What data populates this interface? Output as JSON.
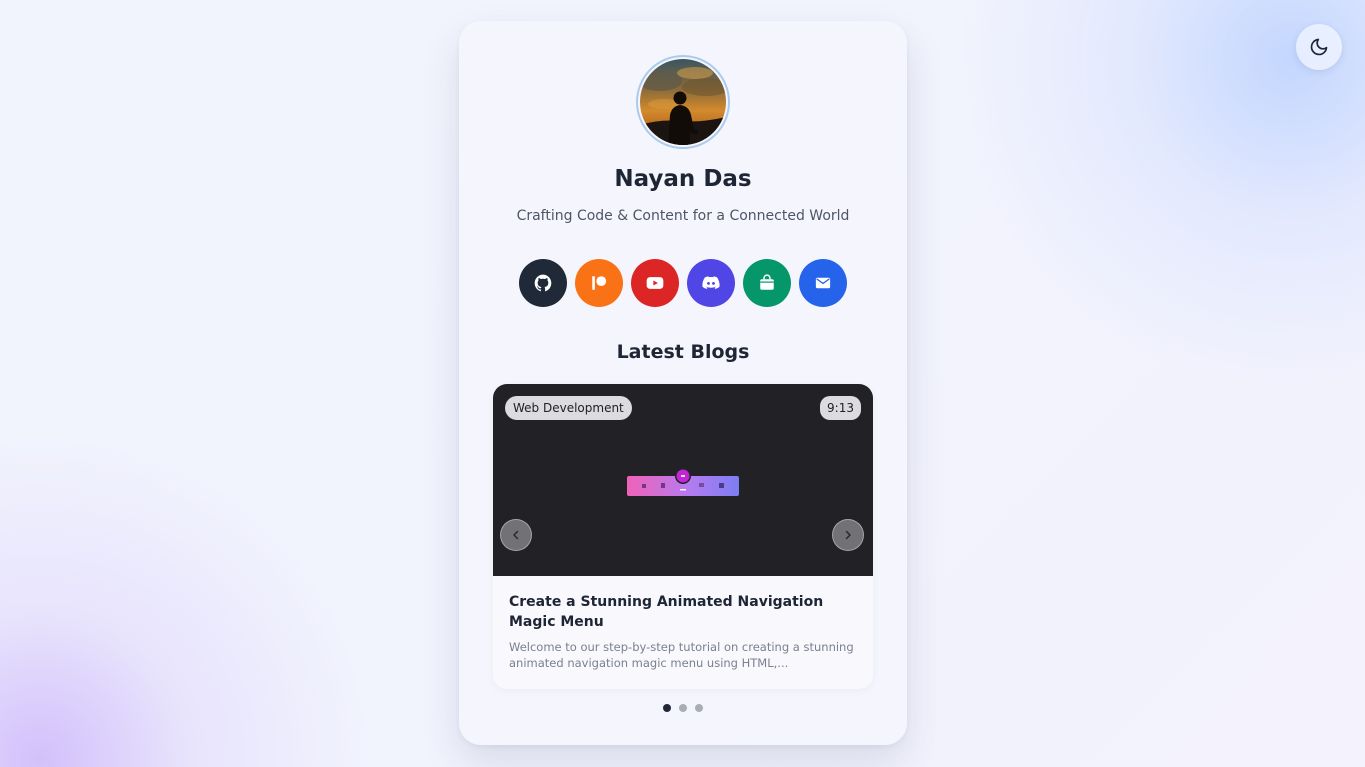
{
  "profile": {
    "name": "Nayan Das",
    "tagline": "Crafting Code & Content for a Connected World",
    "avatar_icon": "silhouette-sunset-photo"
  },
  "theme_toggle": {
    "icon": "moon-icon"
  },
  "social_links": [
    {
      "id": "github",
      "icon": "github-icon",
      "color": "#1f2937"
    },
    {
      "id": "patreon",
      "icon": "patreon-icon",
      "color": "#f97316"
    },
    {
      "id": "youtube",
      "icon": "youtube-icon",
      "color": "#dc2626"
    },
    {
      "id": "discord",
      "icon": "discord-icon",
      "color": "#4f46e5"
    },
    {
      "id": "shop",
      "icon": "shopping-bag-icon",
      "color": "#059669"
    },
    {
      "id": "email",
      "icon": "mail-icon",
      "color": "#2563eb"
    }
  ],
  "blogs": {
    "heading": "Latest Blogs",
    "current": {
      "category": "Web Development",
      "duration": "9:13",
      "title": "Create a Stunning Animated Navigation Magic Menu",
      "excerpt": "Welcome to our step-by-step tutorial on creating a stunning animated navigation magic menu using HTML,..."
    },
    "slide_count": 3,
    "active_slide": 0
  }
}
